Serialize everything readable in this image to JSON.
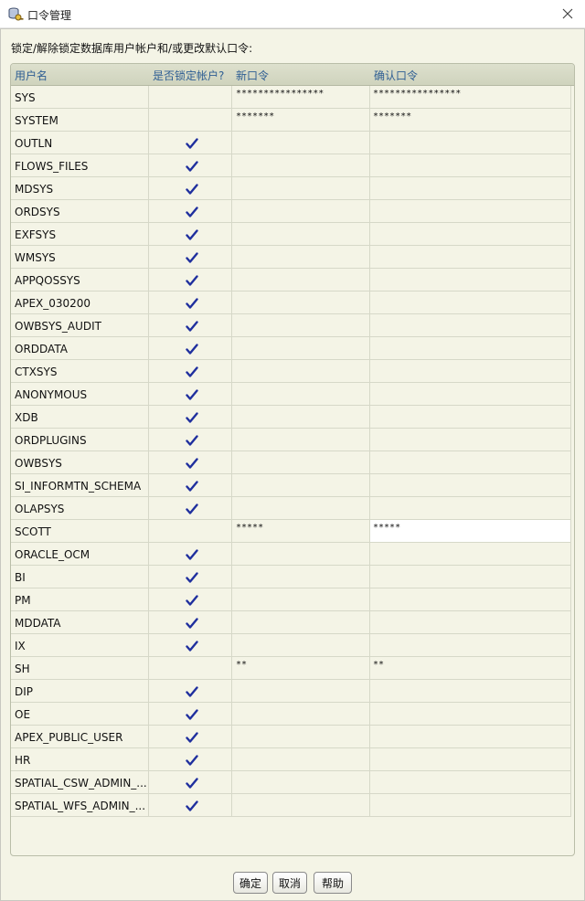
{
  "window": {
    "title": "口令管理",
    "icon": "database-key-icon"
  },
  "instruction": "锁定/解除锁定数据库用户帐户和/或更改默认口令:",
  "table": {
    "columns": [
      "用户名",
      "是否锁定帐户?",
      "新口令",
      "确认口令"
    ],
    "rows": [
      {
        "user": "SYS",
        "locked": false,
        "new_password": "****************",
        "confirm_password": "****************"
      },
      {
        "user": "SYSTEM",
        "locked": false,
        "new_password": "*******",
        "confirm_password": "*******"
      },
      {
        "user": "OUTLN",
        "locked": true,
        "new_password": "",
        "confirm_password": ""
      },
      {
        "user": "FLOWS_FILES",
        "locked": true,
        "new_password": "",
        "confirm_password": ""
      },
      {
        "user": "MDSYS",
        "locked": true,
        "new_password": "",
        "confirm_password": ""
      },
      {
        "user": "ORDSYS",
        "locked": true,
        "new_password": "",
        "confirm_password": ""
      },
      {
        "user": "EXFSYS",
        "locked": true,
        "new_password": "",
        "confirm_password": ""
      },
      {
        "user": "WMSYS",
        "locked": true,
        "new_password": "",
        "confirm_password": ""
      },
      {
        "user": "APPQOSSYS",
        "locked": true,
        "new_password": "",
        "confirm_password": ""
      },
      {
        "user": "APEX_030200",
        "locked": true,
        "new_password": "",
        "confirm_password": ""
      },
      {
        "user": "OWBSYS_AUDIT",
        "locked": true,
        "new_password": "",
        "confirm_password": ""
      },
      {
        "user": "ORDDATA",
        "locked": true,
        "new_password": "",
        "confirm_password": ""
      },
      {
        "user": "CTXSYS",
        "locked": true,
        "new_password": "",
        "confirm_password": ""
      },
      {
        "user": "ANONYMOUS",
        "locked": true,
        "new_password": "",
        "confirm_password": ""
      },
      {
        "user": "XDB",
        "locked": true,
        "new_password": "",
        "confirm_password": ""
      },
      {
        "user": "ORDPLUGINS",
        "locked": true,
        "new_password": "",
        "confirm_password": ""
      },
      {
        "user": "OWBSYS",
        "locked": true,
        "new_password": "",
        "confirm_password": ""
      },
      {
        "user": "SI_INFORMTN_SCHEMA",
        "locked": true,
        "new_password": "",
        "confirm_password": ""
      },
      {
        "user": "OLAPSYS",
        "locked": true,
        "new_password": "",
        "confirm_password": ""
      },
      {
        "user": "SCOTT",
        "locked": false,
        "new_password": "*****",
        "confirm_password": "*****",
        "selected": true
      },
      {
        "user": "ORACLE_OCM",
        "locked": true,
        "new_password": "",
        "confirm_password": ""
      },
      {
        "user": "BI",
        "locked": true,
        "new_password": "",
        "confirm_password": ""
      },
      {
        "user": "PM",
        "locked": true,
        "new_password": "",
        "confirm_password": ""
      },
      {
        "user": "MDDATA",
        "locked": true,
        "new_password": "",
        "confirm_password": ""
      },
      {
        "user": "IX",
        "locked": true,
        "new_password": "",
        "confirm_password": ""
      },
      {
        "user": "SH",
        "locked": false,
        "new_password": "**",
        "confirm_password": "**"
      },
      {
        "user": "DIP",
        "locked": true,
        "new_password": "",
        "confirm_password": ""
      },
      {
        "user": "OE",
        "locked": true,
        "new_password": "",
        "confirm_password": ""
      },
      {
        "user": "APEX_PUBLIC_USER",
        "locked": true,
        "new_password": "",
        "confirm_password": ""
      },
      {
        "user": "HR",
        "locked": true,
        "new_password": "",
        "confirm_password": ""
      },
      {
        "user": "SPATIAL_CSW_ADMIN_...",
        "locked": true,
        "new_password": "",
        "confirm_password": ""
      },
      {
        "user": "SPATIAL_WFS_ADMIN_...",
        "locked": true,
        "new_password": "",
        "confirm_password": ""
      }
    ]
  },
  "buttons": {
    "ok": "确定",
    "cancel": "取消",
    "help": "帮助"
  },
  "colors": {
    "background": "#f4f4e6",
    "header_text": "#2e5e93",
    "checkmark": "#1f2f9e"
  }
}
